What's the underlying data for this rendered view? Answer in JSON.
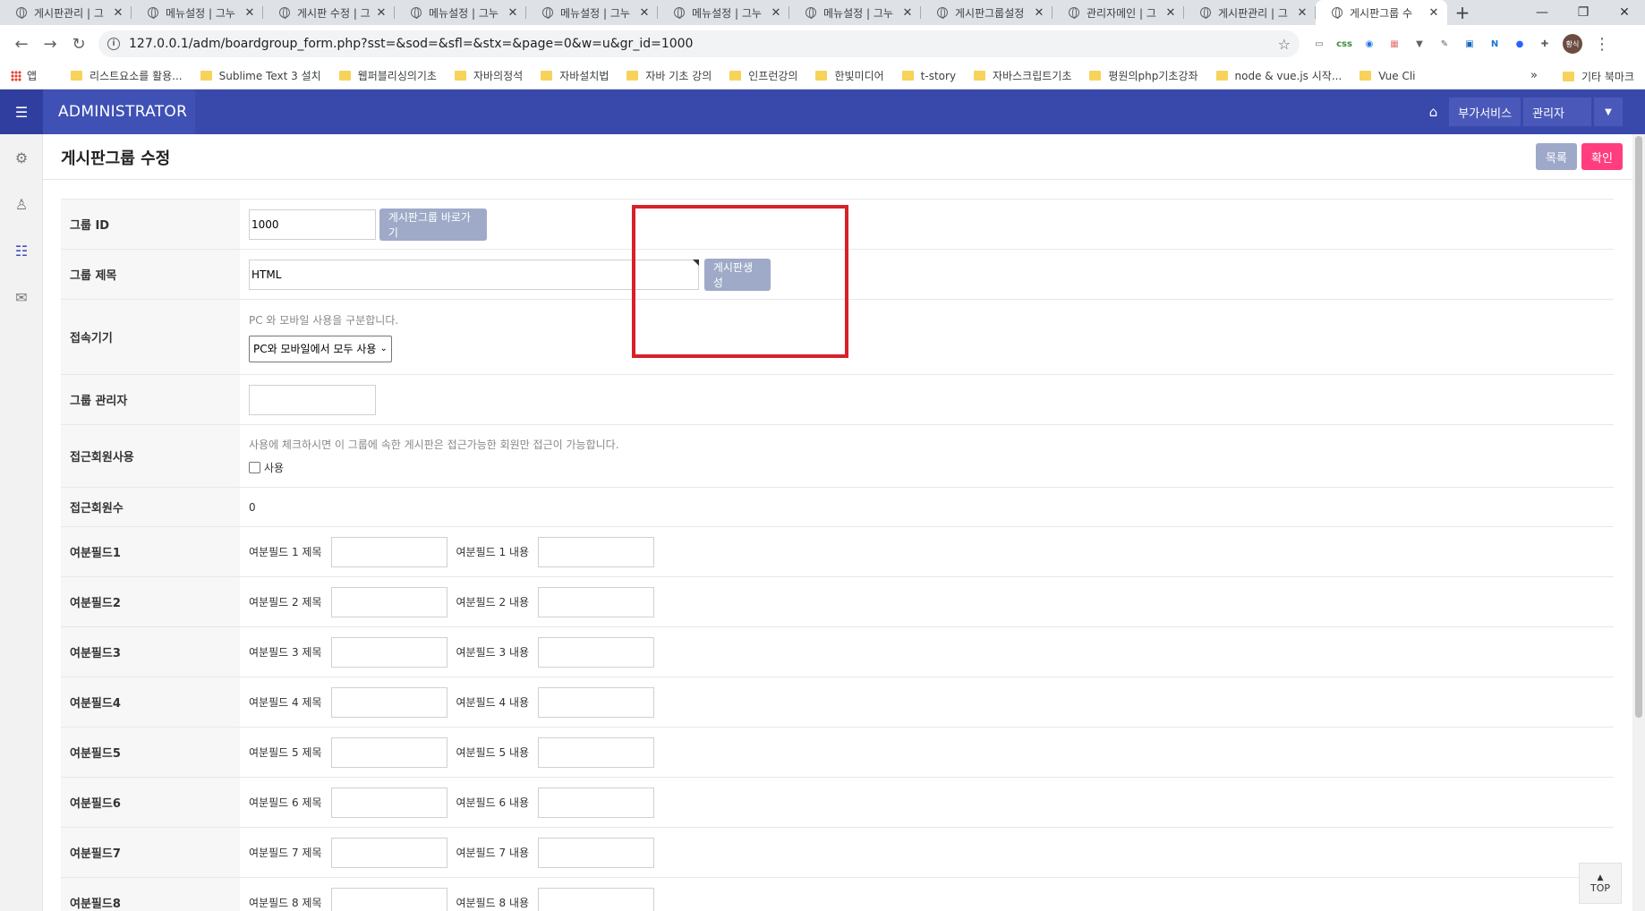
{
  "browser": {
    "tabs": [
      {
        "label": "게시판관리 | 그"
      },
      {
        "label": "메뉴설정 | 그누"
      },
      {
        "label": "게시판 수정 | 그"
      },
      {
        "label": "메뉴설정 | 그누"
      },
      {
        "label": "메뉴설정 | 그누"
      },
      {
        "label": "메뉴설정 | 그누"
      },
      {
        "label": "메뉴설정 | 그누"
      },
      {
        "label": "게시판그룹설정"
      },
      {
        "label": "관리자메인 | 그"
      },
      {
        "label": "게시판관리 | 그"
      },
      {
        "label": "게시판그룹 수"
      }
    ],
    "url": "127.0.0.1/adm/boardgroup_form.php?sst=&sod=&sfl=&stx=&page=0&w=u&gr_id=1000",
    "profile_initials": "황식",
    "extensions": [
      {
        "name": "cast-icon",
        "text": "▭",
        "color": "#5f6368"
      },
      {
        "name": "css-extension-icon",
        "text": "css",
        "color": "#3d8b3d"
      },
      {
        "name": "globe-extension-icon",
        "text": "◉",
        "color": "#1a73e8"
      },
      {
        "name": "calendar-extension-icon",
        "text": "▦",
        "color": "#e57373"
      },
      {
        "name": "vue-extension-icon",
        "text": "▼",
        "color": "#5f6368"
      },
      {
        "name": "eyedropper-icon",
        "text": "✎",
        "color": "#5f6368"
      },
      {
        "name": "printer-extension-icon",
        "text": "▣",
        "color": "#1565c0"
      },
      {
        "name": "n-extension-icon",
        "text": "N",
        "color": "#1976d2"
      },
      {
        "name": "blue-circle-extension-icon",
        "text": "●",
        "color": "#2962ff"
      },
      {
        "name": "puzzle-icon",
        "text": "✚",
        "color": "#5f6368"
      }
    ],
    "bookmarks": [
      "리스트요소를 활용...",
      "Sublime Text 3 설치",
      "웹퍼블리싱의기초",
      "자바의정석",
      "자바설치법",
      "자바 기초 강의",
      "인프런강의",
      "한빛미디어",
      "t-story",
      "자바스크립트기초",
      "평원의php기초강좌",
      "node & vue.js 시작...",
      "Vue Cli"
    ],
    "apps_label": "앱",
    "more_label": "»",
    "other_bookmarks": "기타 북마크"
  },
  "header": {
    "brand": "ADMINISTRATOR",
    "extra_service": "부가서비스",
    "admin_menu": "관리자"
  },
  "page": {
    "title": "게시판그룹 수정",
    "list_button": "목록",
    "confirm_button": "확인"
  },
  "form": {
    "group_id": {
      "label": "그룹 ID",
      "value": "1000",
      "shortcut_button": "게시판그룹 바로가기"
    },
    "group_title": {
      "label": "그룹 제목",
      "value": "HTML",
      "create_button": "게시판생성"
    },
    "device": {
      "label": "접속기기",
      "help": "PC 와 모바일 사용을 구분합니다.",
      "selected": "PC와 모바일에서 모두 사용"
    },
    "group_admin": {
      "label": "그룹 관리자",
      "value": ""
    },
    "member_access": {
      "label": "접근회원사용",
      "help": "사용에 체크하시면 이 그룹에 속한 게시판은 접근가능한 회원만 접근이 가능합니다.",
      "checkbox_label": "사용",
      "checked": false
    },
    "member_count": {
      "label": "접근회원수",
      "value": "0"
    },
    "extra_fields": [
      {
        "label": "여분필드1",
        "subject_label": "여분필드 1 제목",
        "value_label": "여분필드 1 내용"
      },
      {
        "label": "여분필드2",
        "subject_label": "여분필드 2 제목",
        "value_label": "여분필드 2 내용"
      },
      {
        "label": "여분필드3",
        "subject_label": "여분필드 3 제목",
        "value_label": "여분필드 3 내용"
      },
      {
        "label": "여분필드4",
        "subject_label": "여분필드 4 제목",
        "value_label": "여분필드 4 내용"
      },
      {
        "label": "여분필드5",
        "subject_label": "여분필드 5 제목",
        "value_label": "여분필드 5 내용"
      },
      {
        "label": "여분필드6",
        "subject_label": "여분필드 6 제목",
        "value_label": "여분필드 6 내용"
      },
      {
        "label": "여분필드7",
        "subject_label": "여분필드 7 제목",
        "value_label": "여분필드 7 내용"
      },
      {
        "label": "여분필드8",
        "subject_label": "여분필드 8 제목",
        "value_label": "여분필드 8 내용"
      }
    ]
  },
  "top_button": "TOP",
  "highlight_color": "#d8202a",
  "accent_color": "#3f51b5"
}
